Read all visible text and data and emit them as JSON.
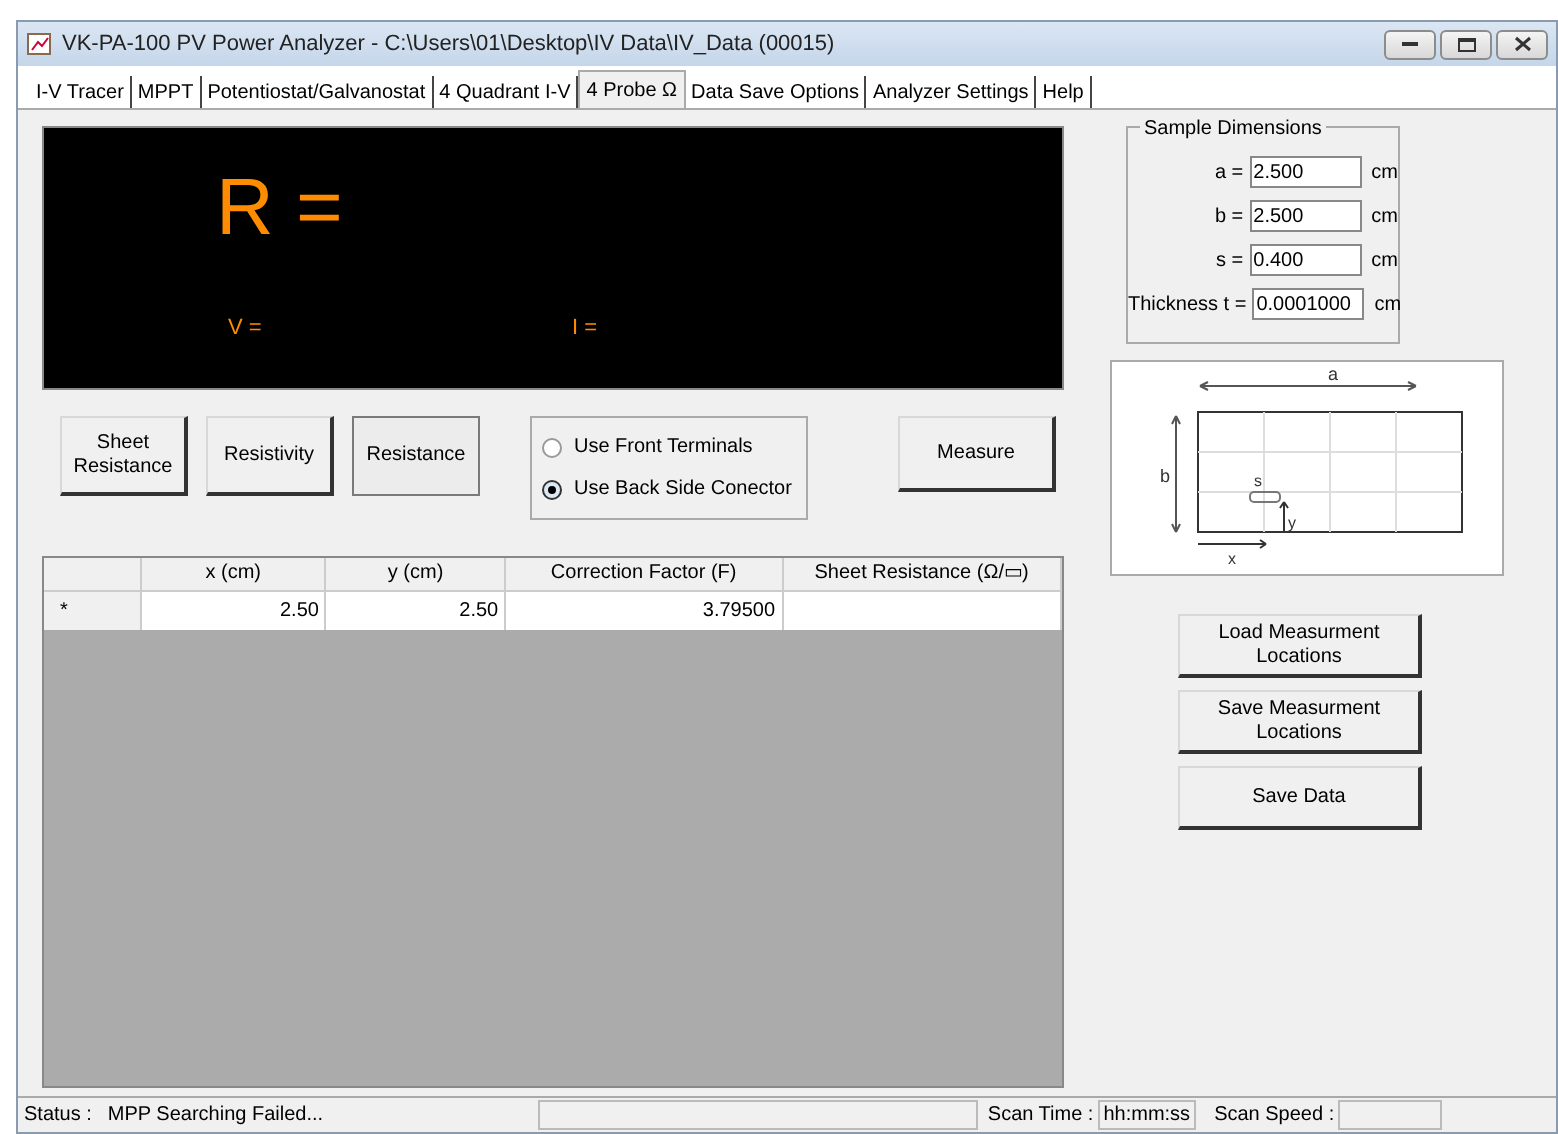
{
  "window": {
    "title": "VK-PA-100 PV Power Analyzer - C:\\Users\\01\\Desktop\\IV Data\\IV_Data (00015)"
  },
  "tabs": [
    {
      "label": "I-V Tracer",
      "selected": false
    },
    {
      "label": "MPPT",
      "selected": false
    },
    {
      "label": "Potentiostat/Galvanostat",
      "selected": false
    },
    {
      "label": "4 Quadrant I-V",
      "selected": false
    },
    {
      "label": "4 Probe Ω",
      "selected": true
    },
    {
      "label": "Data Save Options",
      "selected": false
    },
    {
      "label": "Analyzer Settings",
      "selected": false
    },
    {
      "label": "Help",
      "selected": false
    }
  ],
  "display": {
    "main": "R =",
    "voltage": "V =",
    "current": "I ="
  },
  "mode_buttons": [
    {
      "label": "Sheet Resistance",
      "selected": false
    },
    {
      "label": "Resistivity",
      "selected": false
    },
    {
      "label": "Resistance",
      "selected": true
    }
  ],
  "terminals": [
    {
      "label": "Use Front Terminals",
      "selected": false
    },
    {
      "label": "Use Back Side Conector",
      "selected": true
    }
  ],
  "measure_button": "Measure",
  "table": {
    "columns": [
      "x (cm)",
      "y (cm)",
      "Correction Factor (F)",
      "Sheet Resistance (Ω/▭)"
    ],
    "rows": [
      {
        "marker": "*",
        "cells": [
          "2.50",
          "2.50",
          "3.79500",
          ""
        ]
      }
    ]
  },
  "sample_dimensions": {
    "title": "Sample Dimensions",
    "fields": [
      {
        "label": "a =",
        "value": "2.500",
        "unit": "cm"
      },
      {
        "label": "b =",
        "value": "2.500",
        "unit": "cm"
      },
      {
        "label": "s =",
        "value": "0.400",
        "unit": "cm"
      },
      {
        "label": "Thickness t =",
        "value": "0.0001000",
        "unit": "cm"
      }
    ]
  },
  "diagram": {
    "a": "a",
    "b": "b",
    "s": "s",
    "x": "x",
    "y": "y"
  },
  "action_buttons": [
    "Load Measurment Locations",
    "Save Measurment Locations",
    "Save Data"
  ],
  "status_bar": {
    "status_label": "Status :",
    "status": "MPP Searching Failed...",
    "scan_time_label": "Scan Time :",
    "scan_time": "hh:mm:ss",
    "scan_speed_label": "Scan Speed :"
  }
}
